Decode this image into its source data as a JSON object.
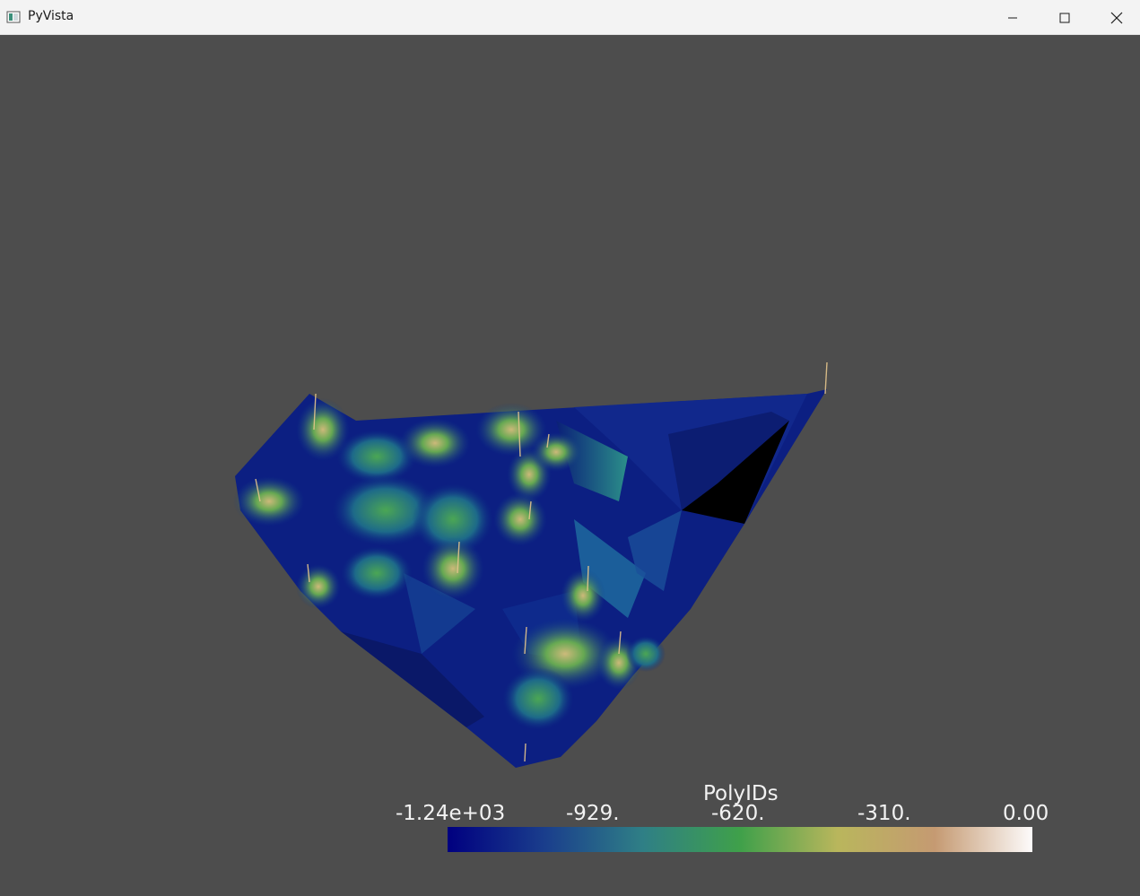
{
  "window": {
    "title": "PyVista",
    "app_icon": "pyvista-app-icon",
    "controls": [
      "minimize-icon",
      "maximize-icon",
      "close-icon"
    ]
  },
  "viewport": {
    "background": "#4d4d4d",
    "object": "3D terrain mesh surface",
    "colormap": "gist_earth"
  },
  "scalar_bar": {
    "title": "PolyIDs",
    "ticks": [
      "-1.24e+03",
      "-929.",
      "-620.",
      "-310.",
      "0.00"
    ],
    "range": [
      -1240,
      0
    ],
    "colors": [
      "#000080",
      "#1a3e8c",
      "#2f7f86",
      "#3fa04a",
      "#b9b65c",
      "#c59a72",
      "#fdfbfb"
    ]
  }
}
